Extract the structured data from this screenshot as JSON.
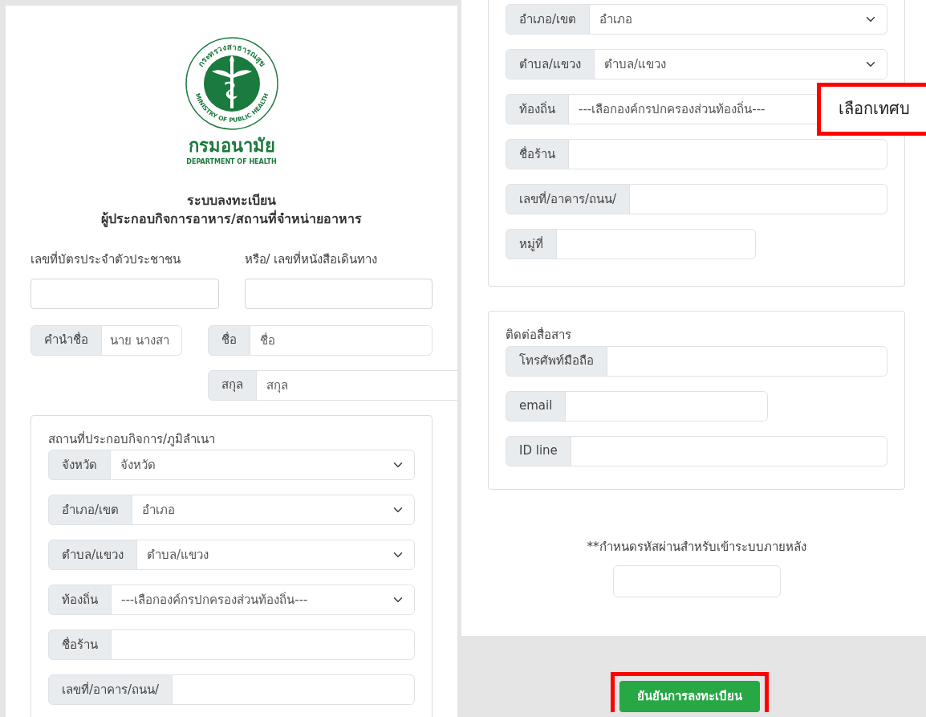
{
  "logo": {
    "ring_top": "กระทรวงสาธารณสุข",
    "ring_bottom": "MINISTRY OF PUBLIC HEALTH",
    "name": "กรมอนามัย",
    "name_en": "DEPARTMENT OF HEALTH"
  },
  "title_lines": [
    "ระบบลงทะเบียน",
    "ผู้ประกอบกิจการอาหาร/สถานที่จำหน่ายอาหาร"
  ],
  "id_fields": [
    {
      "label": "เลขที่บัตรประจำตัวประชาชน"
    },
    {
      "label": "หรือ/ เลขที่หนังสือเดินทาง"
    }
  ],
  "name_fields": [
    {
      "addon": "คำนำชื่อ",
      "placeholder": "นาย นางสา"
    },
    {
      "addon": "ชื่อ",
      "placeholder": "ชื่อ"
    },
    {
      "addon": "สกุล",
      "placeholder": "สกุล"
    }
  ],
  "left_address": {
    "legend": "สถานที่ประกอบกิจการ/ภูมิลำเนา",
    "rows": [
      {
        "kind": "select",
        "addon": "จังหวัด",
        "value": "จังหวัด"
      },
      {
        "kind": "select",
        "addon": "อำเภอ/เขต",
        "value": "อำเภอ"
      },
      {
        "kind": "select",
        "addon": "ตำบล/แขวง",
        "value": "ตำบล/แขวง"
      },
      {
        "kind": "select",
        "addon": "ท้องถิ่น",
        "value": "---เลือกองค์กรปกครองส่วนท้องถิ่น---"
      },
      {
        "kind": "input",
        "addon": "ชื่อร้าน"
      },
      {
        "kind": "input",
        "addon": "เลขที่/อาคาร/ถนน/"
      }
    ]
  },
  "right_address": {
    "rows": [
      {
        "kind": "select",
        "addon": "อำเภอ/เขต",
        "value": "อำเภอ"
      },
      {
        "kind": "select",
        "addon": "ตำบล/แขวง",
        "value": "ตำบล/แขวง"
      },
      {
        "kind": "select",
        "addon": "ท้องถิ่น",
        "value": "---เลือกองค์กรปกครองส่วนท้องถิ่น---"
      },
      {
        "kind": "input",
        "addon": "ชื่อร้าน"
      },
      {
        "kind": "input",
        "addon": "เลขที่/อาคาร/ถนน/"
      },
      {
        "kind": "short",
        "addon": "หมู่ที่"
      }
    ]
  },
  "contact": {
    "legend": "ติดต่อสื่อสาร",
    "rows": [
      {
        "kind": "input",
        "addon": "โทรศัพท์มือถือ"
      },
      {
        "kind": "short",
        "addon": "email"
      },
      {
        "kind": "input",
        "addon": "ID line"
      }
    ]
  },
  "password": {
    "label": "**กำหนดรหัสผ่านสำหรับเข้าระบบภายหลัง"
  },
  "submit": {
    "label": "ยันยันการลงทะเบียน"
  },
  "annotation": {
    "text": "เลือกเทศบ"
  }
}
